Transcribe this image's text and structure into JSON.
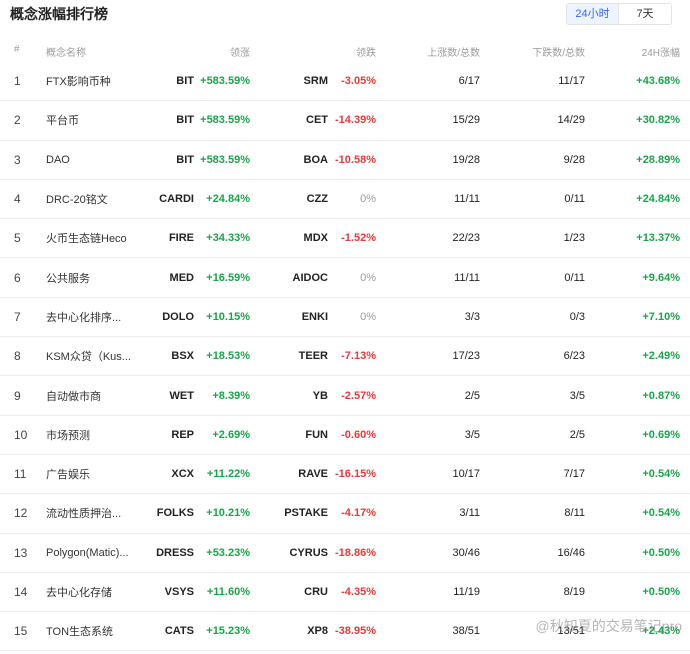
{
  "page": {
    "title": "概念涨幅排行榜",
    "tabs": [
      {
        "label": "24小时",
        "active": true
      },
      {
        "label": "7天",
        "active": false
      }
    ]
  },
  "columns": {
    "idx": "#",
    "name": "概念名称",
    "leader": "领涨",
    "faller": "领跌",
    "up": "上涨数/总数",
    "down": "下跌数/总数",
    "change24h": "24H涨幅"
  },
  "rows": [
    {
      "idx": "1",
      "name": "FTX影响币种",
      "lsym": "BIT",
      "lpct": "+583.59%",
      "fsym": "SRM",
      "fpct": "-3.05%",
      "fsign": "neg",
      "up": "6/17",
      "down": "11/17",
      "c24": "+43.68%"
    },
    {
      "idx": "2",
      "name": "平台币",
      "lsym": "BIT",
      "lpct": "+583.59%",
      "fsym": "CET",
      "fpct": "-14.39%",
      "fsign": "neg",
      "up": "15/29",
      "down": "14/29",
      "c24": "+30.82%"
    },
    {
      "idx": "3",
      "name": "DAO",
      "lsym": "BIT",
      "lpct": "+583.59%",
      "fsym": "BOA",
      "fpct": "-10.58%",
      "fsign": "neg",
      "up": "19/28",
      "down": "9/28",
      "c24": "+28.89%"
    },
    {
      "idx": "4",
      "name": "DRC-20铭文",
      "lsym": "CARDI",
      "lpct": "+24.84%",
      "fsym": "CZZ",
      "fpct": "0%",
      "fsign": "zero",
      "up": "11/11",
      "down": "0/11",
      "c24": "+24.84%"
    },
    {
      "idx": "5",
      "name": "火币生态链Heco",
      "lsym": "FIRE",
      "lpct": "+34.33%",
      "fsym": "MDX",
      "fpct": "-1.52%",
      "fsign": "neg",
      "up": "22/23",
      "down": "1/23",
      "c24": "+13.37%"
    },
    {
      "idx": "6",
      "name": "公共服务",
      "lsym": "MED",
      "lpct": "+16.59%",
      "fsym": "AIDOC",
      "fpct": "0%",
      "fsign": "zero",
      "up": "11/11",
      "down": "0/11",
      "c24": "+9.64%"
    },
    {
      "idx": "7",
      "name": "去中心化排序...",
      "lsym": "DOLO",
      "lpct": "+10.15%",
      "fsym": "ENKI",
      "fpct": "0%",
      "fsign": "zero",
      "up": "3/3",
      "down": "0/3",
      "c24": "+7.10%"
    },
    {
      "idx": "8",
      "name": "KSM众贷（Kus...",
      "lsym": "BSX",
      "lpct": "+18.53%",
      "fsym": "TEER",
      "fpct": "-7.13%",
      "fsign": "neg",
      "up": "17/23",
      "down": "6/23",
      "c24": "+2.49%"
    },
    {
      "idx": "9",
      "name": "自动做市商",
      "lsym": "WET",
      "lpct": "+8.39%",
      "fsym": "YB",
      "fpct": "-2.57%",
      "fsign": "neg",
      "up": "2/5",
      "down": "3/5",
      "c24": "+0.87%"
    },
    {
      "idx": "10",
      "name": "市场预测",
      "lsym": "REP",
      "lpct": "+2.69%",
      "fsym": "FUN",
      "fpct": "-0.60%",
      "fsign": "neg",
      "up": "3/5",
      "down": "2/5",
      "c24": "+0.69%"
    },
    {
      "idx": "11",
      "name": "广告娱乐",
      "lsym": "XCX",
      "lpct": "+11.22%",
      "fsym": "RAVE",
      "fpct": "-16.15%",
      "fsign": "neg",
      "up": "10/17",
      "down": "7/17",
      "c24": "+0.54%"
    },
    {
      "idx": "12",
      "name": "流动性质押治...",
      "lsym": "FOLKS",
      "lpct": "+10.21%",
      "fsym": "PSTAKE",
      "fpct": "-4.17%",
      "fsign": "neg",
      "up": "3/11",
      "down": "8/11",
      "c24": "+0.54%"
    },
    {
      "idx": "13",
      "name": "Polygon(Matic)...",
      "lsym": "DRESS",
      "lpct": "+53.23%",
      "fsym": "CYRUS",
      "fpct": "-18.86%",
      "fsign": "neg",
      "up": "30/46",
      "down": "16/46",
      "c24": "+0.50%"
    },
    {
      "idx": "14",
      "name": "去中心化存储",
      "lsym": "VSYS",
      "lpct": "+11.60%",
      "fsym": "CRU",
      "fpct": "-4.35%",
      "fsign": "neg",
      "up": "11/19",
      "down": "8/19",
      "c24": "+0.50%"
    },
    {
      "idx": "15",
      "name": "TON生态系统",
      "lsym": "CATS",
      "lpct": "+15.23%",
      "fsym": "XP8",
      "fpct": "-38.95%",
      "fsign": "neg",
      "up": "38/51",
      "down": "13/51",
      "c24": "+2.43%"
    }
  ],
  "watermark": "@秋知夏的交易笔记pro",
  "colors": {
    "positive": "#1aa34a",
    "negative": "#e53b3b",
    "accent": "#2f6bff",
    "neutral": "#9a9a9a"
  }
}
